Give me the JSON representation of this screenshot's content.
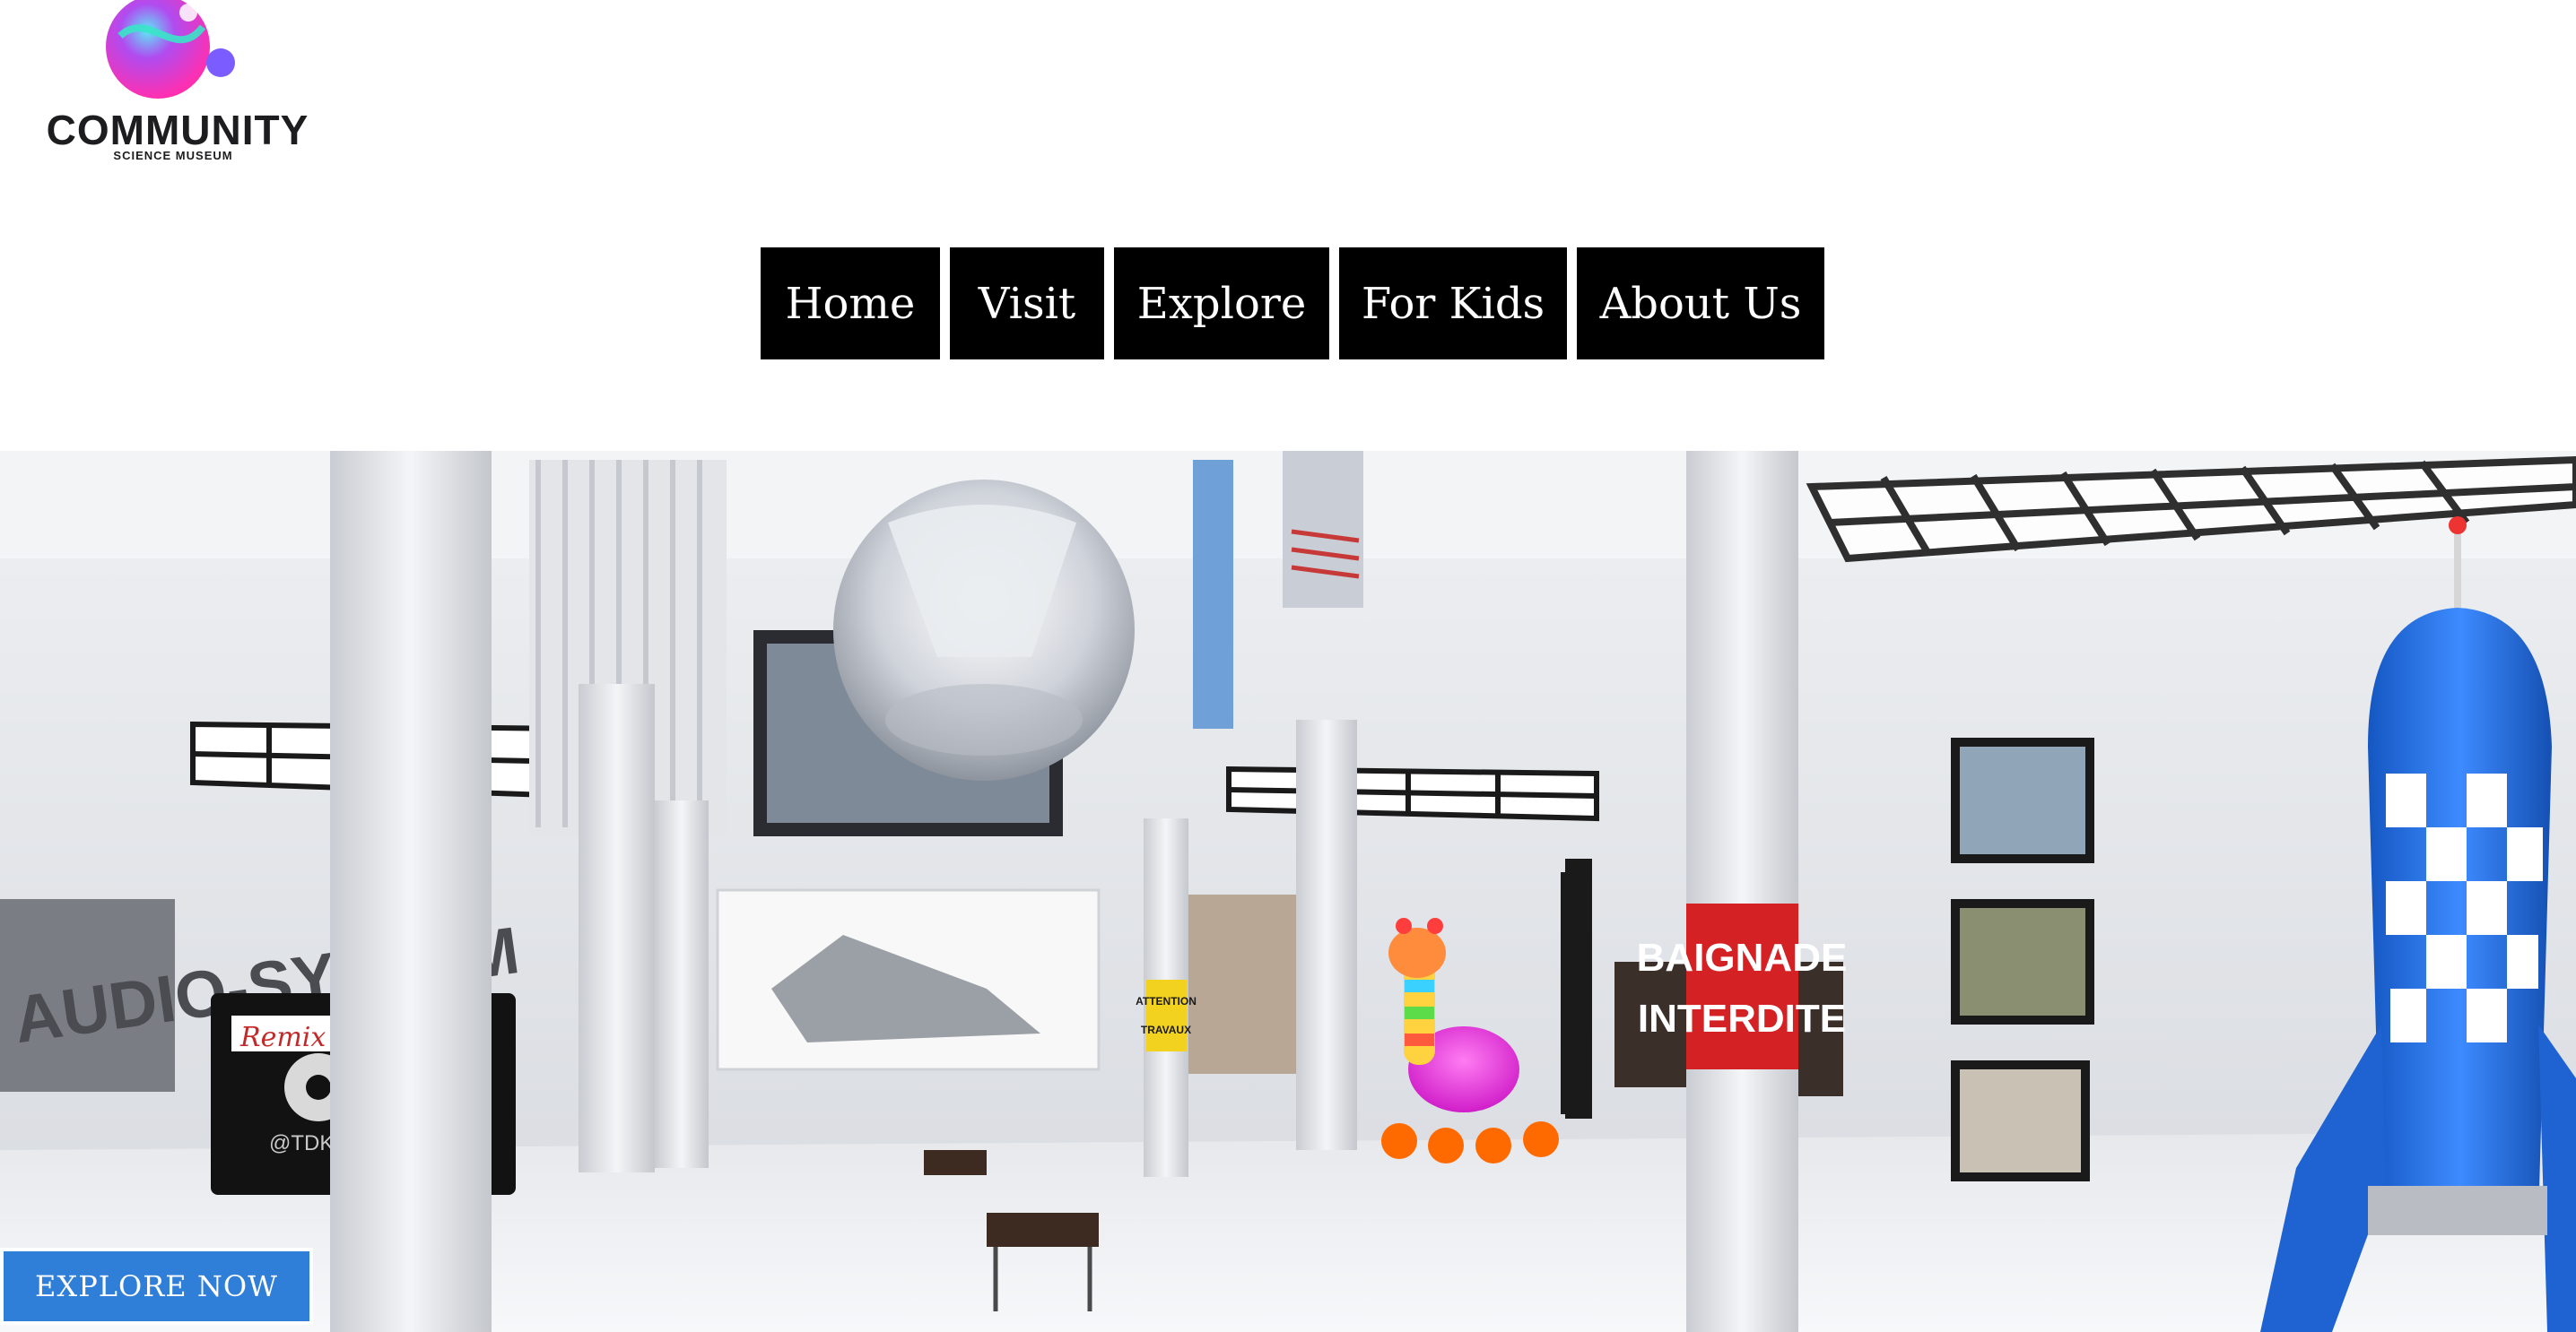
{
  "logo": {
    "name": "COMMUNITY",
    "tagline": "SCIENCE MUSEUM"
  },
  "nav": {
    "items": [
      "Home",
      "Visit",
      "Explore",
      "For Kids",
      "About Us"
    ]
  },
  "hero": {
    "cta_label": "EXPLORE NOW",
    "signs": {
      "left_wall": "AUDIO-SYSTEM",
      "cassette_label": "Remix",
      "cassette_brand": "@TDK",
      "caution_1": "ATTENTION",
      "caution_2": "TRAVAUX",
      "pillar_1": "BAIGNADE",
      "pillar_2": "INTERDITE"
    }
  },
  "colors": {
    "nav_bg": "#000000",
    "nav_text": "#ffffff",
    "cta_bg": "#2f7fd9",
    "pillar_sign": "#d32124",
    "rocket": "#1f6fe0"
  }
}
